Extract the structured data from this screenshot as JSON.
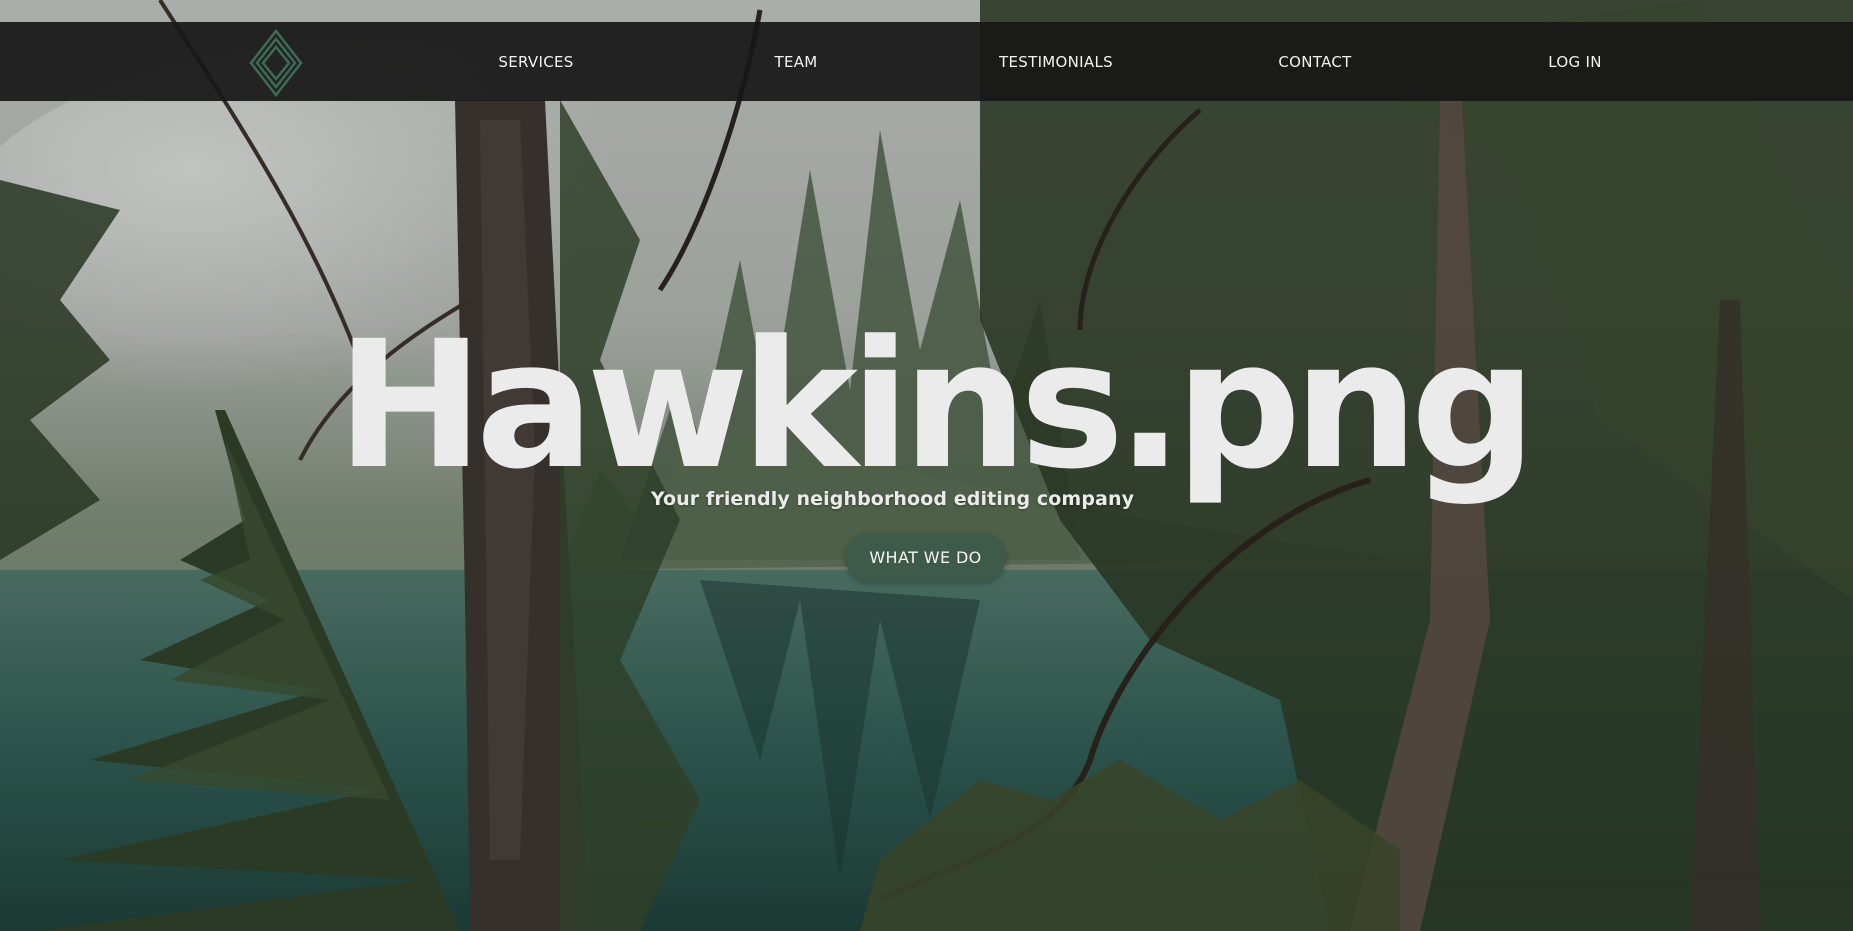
{
  "nav": {
    "logo_icon": "diamond-logo-icon",
    "items": [
      {
        "label": "SERVICES"
      },
      {
        "label": "TEAM"
      },
      {
        "label": "TESTIMONIALS"
      },
      {
        "label": "CONTACT"
      },
      {
        "label": "LOG IN"
      }
    ]
  },
  "hero": {
    "title": "Hawkins.png",
    "subtitle": "Your friendly neighborhood editing company",
    "cta_label": "WHAT WE DO"
  },
  "colors": {
    "nav_background": "#181818",
    "logo_green": "#3d6b58",
    "button_green": "#3d5a4a",
    "text_light": "#ecebec"
  }
}
